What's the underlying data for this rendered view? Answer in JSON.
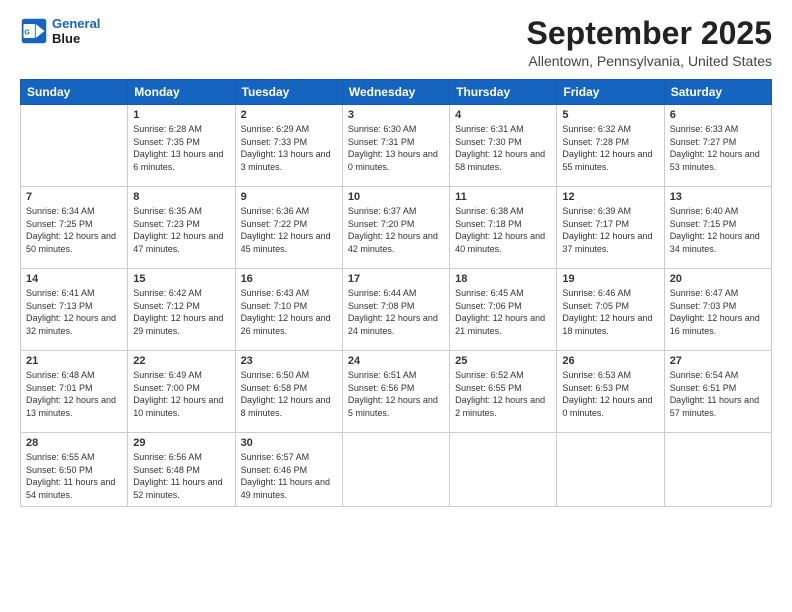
{
  "header": {
    "logo_line1": "General",
    "logo_line2": "Blue",
    "month": "September 2025",
    "location": "Allentown, Pennsylvania, United States"
  },
  "weekdays": [
    "Sunday",
    "Monday",
    "Tuesday",
    "Wednesday",
    "Thursday",
    "Friday",
    "Saturday"
  ],
  "weeks": [
    [
      {
        "day": "",
        "empty": true
      },
      {
        "day": "1",
        "sunrise": "Sunrise: 6:28 AM",
        "sunset": "Sunset: 7:35 PM",
        "daylight": "Daylight: 13 hours and 6 minutes."
      },
      {
        "day": "2",
        "sunrise": "Sunrise: 6:29 AM",
        "sunset": "Sunset: 7:33 PM",
        "daylight": "Daylight: 13 hours and 3 minutes."
      },
      {
        "day": "3",
        "sunrise": "Sunrise: 6:30 AM",
        "sunset": "Sunset: 7:31 PM",
        "daylight": "Daylight: 13 hours and 0 minutes."
      },
      {
        "day": "4",
        "sunrise": "Sunrise: 6:31 AM",
        "sunset": "Sunset: 7:30 PM",
        "daylight": "Daylight: 12 hours and 58 minutes."
      },
      {
        "day": "5",
        "sunrise": "Sunrise: 6:32 AM",
        "sunset": "Sunset: 7:28 PM",
        "daylight": "Daylight: 12 hours and 55 minutes."
      },
      {
        "day": "6",
        "sunrise": "Sunrise: 6:33 AM",
        "sunset": "Sunset: 7:27 PM",
        "daylight": "Daylight: 12 hours and 53 minutes."
      }
    ],
    [
      {
        "day": "7",
        "sunrise": "Sunrise: 6:34 AM",
        "sunset": "Sunset: 7:25 PM",
        "daylight": "Daylight: 12 hours and 50 minutes."
      },
      {
        "day": "8",
        "sunrise": "Sunrise: 6:35 AM",
        "sunset": "Sunset: 7:23 PM",
        "daylight": "Daylight: 12 hours and 47 minutes."
      },
      {
        "day": "9",
        "sunrise": "Sunrise: 6:36 AM",
        "sunset": "Sunset: 7:22 PM",
        "daylight": "Daylight: 12 hours and 45 minutes."
      },
      {
        "day": "10",
        "sunrise": "Sunrise: 6:37 AM",
        "sunset": "Sunset: 7:20 PM",
        "daylight": "Daylight: 12 hours and 42 minutes."
      },
      {
        "day": "11",
        "sunrise": "Sunrise: 6:38 AM",
        "sunset": "Sunset: 7:18 PM",
        "daylight": "Daylight: 12 hours and 40 minutes."
      },
      {
        "day": "12",
        "sunrise": "Sunrise: 6:39 AM",
        "sunset": "Sunset: 7:17 PM",
        "daylight": "Daylight: 12 hours and 37 minutes."
      },
      {
        "day": "13",
        "sunrise": "Sunrise: 6:40 AM",
        "sunset": "Sunset: 7:15 PM",
        "daylight": "Daylight: 12 hours and 34 minutes."
      }
    ],
    [
      {
        "day": "14",
        "sunrise": "Sunrise: 6:41 AM",
        "sunset": "Sunset: 7:13 PM",
        "daylight": "Daylight: 12 hours and 32 minutes."
      },
      {
        "day": "15",
        "sunrise": "Sunrise: 6:42 AM",
        "sunset": "Sunset: 7:12 PM",
        "daylight": "Daylight: 12 hours and 29 minutes."
      },
      {
        "day": "16",
        "sunrise": "Sunrise: 6:43 AM",
        "sunset": "Sunset: 7:10 PM",
        "daylight": "Daylight: 12 hours and 26 minutes."
      },
      {
        "day": "17",
        "sunrise": "Sunrise: 6:44 AM",
        "sunset": "Sunset: 7:08 PM",
        "daylight": "Daylight: 12 hours and 24 minutes."
      },
      {
        "day": "18",
        "sunrise": "Sunrise: 6:45 AM",
        "sunset": "Sunset: 7:06 PM",
        "daylight": "Daylight: 12 hours and 21 minutes."
      },
      {
        "day": "19",
        "sunrise": "Sunrise: 6:46 AM",
        "sunset": "Sunset: 7:05 PM",
        "daylight": "Daylight: 12 hours and 18 minutes."
      },
      {
        "day": "20",
        "sunrise": "Sunrise: 6:47 AM",
        "sunset": "Sunset: 7:03 PM",
        "daylight": "Daylight: 12 hours and 16 minutes."
      }
    ],
    [
      {
        "day": "21",
        "sunrise": "Sunrise: 6:48 AM",
        "sunset": "Sunset: 7:01 PM",
        "daylight": "Daylight: 12 hours and 13 minutes."
      },
      {
        "day": "22",
        "sunrise": "Sunrise: 6:49 AM",
        "sunset": "Sunset: 7:00 PM",
        "daylight": "Daylight: 12 hours and 10 minutes."
      },
      {
        "day": "23",
        "sunrise": "Sunrise: 6:50 AM",
        "sunset": "Sunset: 6:58 PM",
        "daylight": "Daylight: 12 hours and 8 minutes."
      },
      {
        "day": "24",
        "sunrise": "Sunrise: 6:51 AM",
        "sunset": "Sunset: 6:56 PM",
        "daylight": "Daylight: 12 hours and 5 minutes."
      },
      {
        "day": "25",
        "sunrise": "Sunrise: 6:52 AM",
        "sunset": "Sunset: 6:55 PM",
        "daylight": "Daylight: 12 hours and 2 minutes."
      },
      {
        "day": "26",
        "sunrise": "Sunrise: 6:53 AM",
        "sunset": "Sunset: 6:53 PM",
        "daylight": "Daylight: 12 hours and 0 minutes."
      },
      {
        "day": "27",
        "sunrise": "Sunrise: 6:54 AM",
        "sunset": "Sunset: 6:51 PM",
        "daylight": "Daylight: 11 hours and 57 minutes."
      }
    ],
    [
      {
        "day": "28",
        "sunrise": "Sunrise: 6:55 AM",
        "sunset": "Sunset: 6:50 PM",
        "daylight": "Daylight: 11 hours and 54 minutes."
      },
      {
        "day": "29",
        "sunrise": "Sunrise: 6:56 AM",
        "sunset": "Sunset: 6:48 PM",
        "daylight": "Daylight: 11 hours and 52 minutes."
      },
      {
        "day": "30",
        "sunrise": "Sunrise: 6:57 AM",
        "sunset": "Sunset: 6:46 PM",
        "daylight": "Daylight: 11 hours and 49 minutes."
      },
      {
        "day": "",
        "empty": true
      },
      {
        "day": "",
        "empty": true
      },
      {
        "day": "",
        "empty": true
      },
      {
        "day": "",
        "empty": true
      }
    ]
  ]
}
